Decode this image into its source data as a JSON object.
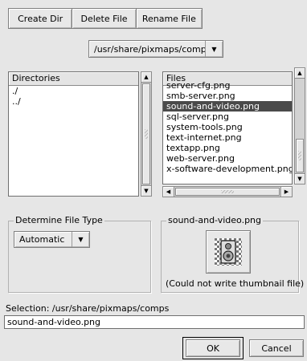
{
  "toolbar": {
    "create_dir": "Create Dir",
    "delete_file": "Delete File",
    "rename_file": "Rename File"
  },
  "path_combo": {
    "value": "/usr/share/pixmaps/comps"
  },
  "directories": {
    "header": "Directories",
    "items": [
      "./",
      "../"
    ]
  },
  "files": {
    "header": "Files",
    "items": [
      "server-cfg.png",
      "smb-server.png",
      "sound-and-video.png",
      "sql-server.png",
      "system-tools.png",
      "text-internet.png",
      "textapp.png",
      "web-server.png",
      "x-software-development.png"
    ],
    "selected_index": 2
  },
  "file_type": {
    "legend": "Determine File Type",
    "value": "Automatic"
  },
  "preview": {
    "legend": "sound-and-video.png",
    "message": "(Could not write thumbnail file)",
    "icon": "speaker-icon"
  },
  "selection": {
    "label": "Selection: /usr/share/pixmaps/comps",
    "value": "sound-and-video.png"
  },
  "dialog": {
    "ok": "OK",
    "cancel": "Cancel"
  }
}
